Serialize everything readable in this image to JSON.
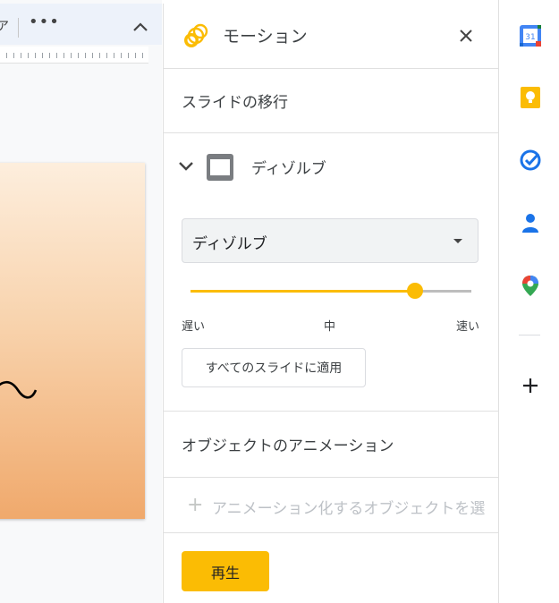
{
  "editor": {
    "toolbar_partial_text": "ア",
    "more_glyph": "•••",
    "collapse_icon": "chevron-up-icon"
  },
  "panel": {
    "title": "モーション",
    "title_icon": "motion-icon",
    "close_icon": "close-icon",
    "slide_transition_label": "スライドの移行",
    "transition": {
      "name": "ディゾルブ",
      "dropdown_value": "ディゾルブ",
      "speed": {
        "value_fraction": 0.8,
        "label_slow": "遅い",
        "label_medium": "中",
        "label_fast": "速い"
      },
      "apply_all_label": "すべてのスライドに適用"
    },
    "object_animation_label": "オブジェクトのアニメーション",
    "add_animation_placeholder": "アニメーション化するオブジェクトを選",
    "play_label": "再生"
  },
  "side_panel": {
    "apps": [
      {
        "name": "calendar",
        "label": "31"
      },
      {
        "name": "keep"
      },
      {
        "name": "tasks"
      },
      {
        "name": "contacts"
      },
      {
        "name": "maps"
      }
    ],
    "add_icon": "plus-icon"
  },
  "colors": {
    "accent": "#fbbc04",
    "slider_track": "#bdbdbd",
    "divider": "#e0e0e0",
    "text": "#3c4043"
  }
}
